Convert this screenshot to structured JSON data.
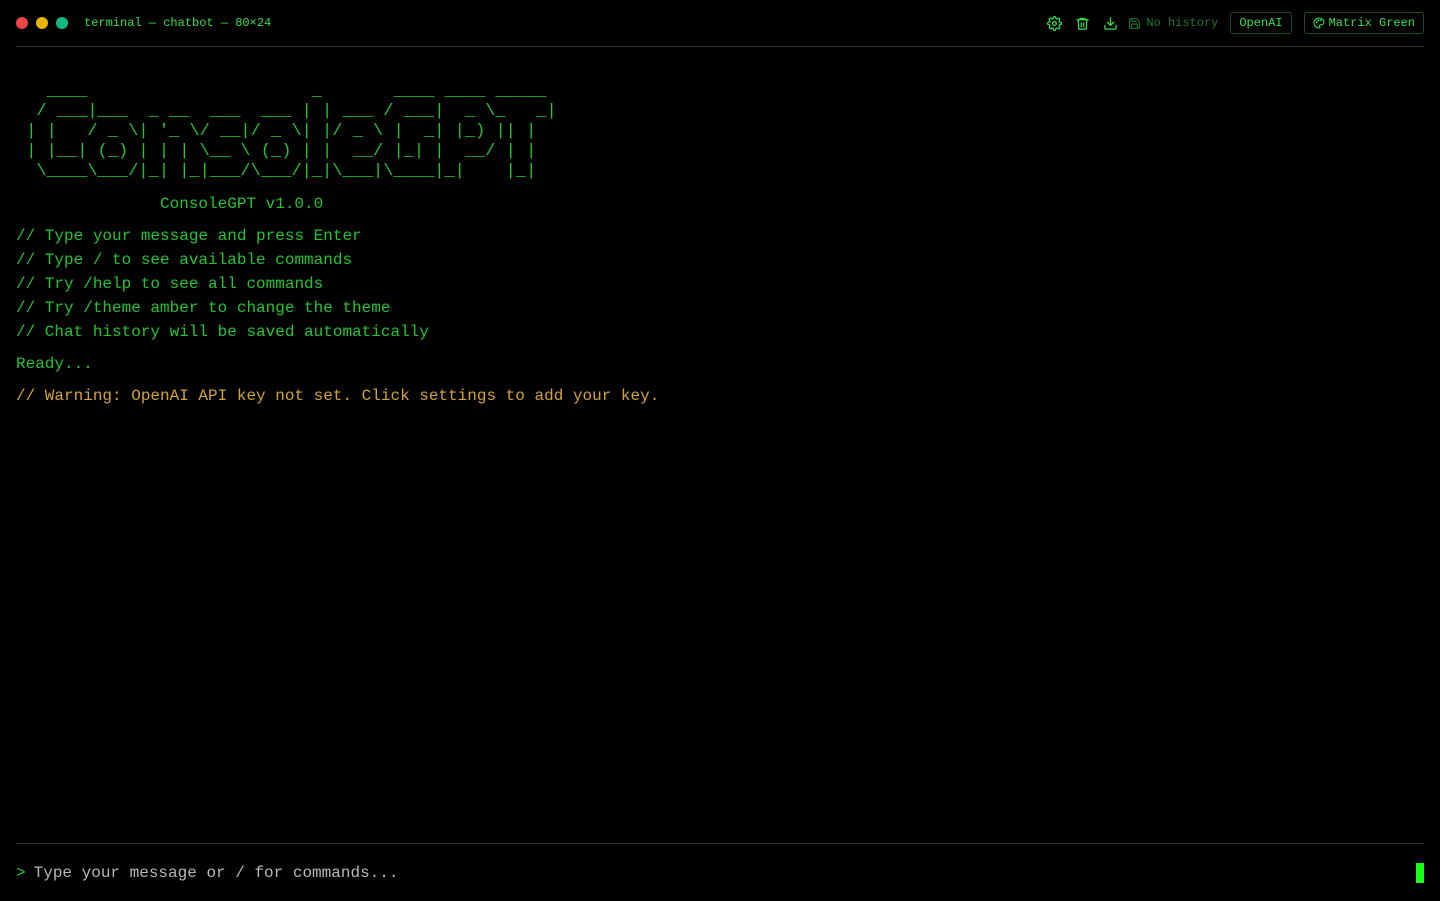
{
  "window": {
    "title": "terminal — chatbot — 80×24",
    "traffic_lights": {
      "close": "#ef4444",
      "minimize": "#eab308",
      "maximize": "#10b981"
    }
  },
  "toolbar": {
    "settings_icon": "gear-icon",
    "clear_icon": "trash-icon",
    "download_icon": "download-icon",
    "history_icon": "save-icon",
    "history_label": "No history",
    "provider_label": "OpenAI",
    "theme_icon": "palette-icon",
    "theme_label": "Matrix Green"
  },
  "banner": {
    "ascii_art": "   ____                      _       ____ ____ _____\n  / ___|___  _ __  ___  ___ | | ___ / ___|  _ \\_   _|\n | |   / _ \\| '_ \\/ __|/ _ \\| |/ _ \\ |  _| |_) || |\n | |__| (_) | | | \\__ \\ (_) | |  __/ |_| |  __/ | |\n  \\____\\___/|_| |_|___/\\___/|_|\\___|\\____|_|    |_|",
    "version": "ConsoleGPT v1.0.0"
  },
  "tips": [
    "// Type your message and press Enter",
    "// Type / to see available commands",
    "// Try /help to see all commands",
    "// Try /theme amber to change the theme",
    "// Chat history will be saved automatically"
  ],
  "status": "Ready...",
  "warning": "// Warning: OpenAI API key not set. Click settings to add your key.",
  "input": {
    "prompt": ">",
    "placeholder": "Type your message or / for commands...",
    "value": ""
  },
  "colors": {
    "text": "#22c530",
    "accent": "#33e04a",
    "warning": "#d4a23a",
    "cursor": "#1aff1a",
    "background": "#000000"
  }
}
